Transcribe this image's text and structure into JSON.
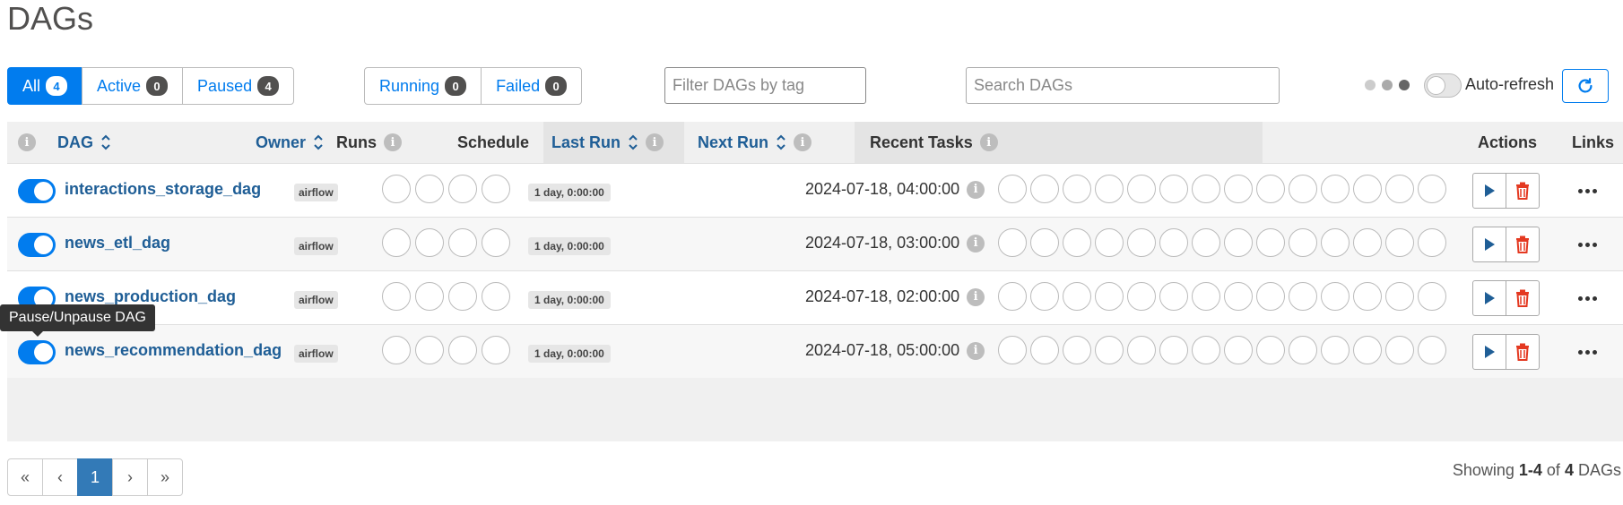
{
  "page": {
    "title": "DAGs"
  },
  "status_filter": [
    {
      "label": "All",
      "count": "4",
      "selected": true
    },
    {
      "label": "Active",
      "count": "0",
      "selected": false
    },
    {
      "label": "Paused",
      "count": "4",
      "selected": false
    }
  ],
  "run_filter": [
    {
      "label": "Running",
      "count": "0"
    },
    {
      "label": "Failed",
      "count": "0"
    }
  ],
  "tag_filter": {
    "placeholder": "Filter DAGs by tag"
  },
  "search": {
    "placeholder": "Search DAGs"
  },
  "auto_refresh": {
    "label": "Auto-refresh",
    "enabled": false
  },
  "table": {
    "headers": {
      "dag": "DAG",
      "owner": "Owner",
      "runs": "Runs",
      "schedule": "Schedule",
      "last_run": "Last Run",
      "next_run": "Next Run",
      "recent_tasks": "Recent Tasks",
      "actions": "Actions",
      "links": "Links"
    },
    "rows": [
      {
        "name": "interactions_storage_dag",
        "owner": "airflow",
        "schedule": "1 day, 0:00:00",
        "last_run": "",
        "next_run": "2024-07-18, 04:00:00",
        "active": true
      },
      {
        "name": "news_etl_dag",
        "owner": "airflow",
        "schedule": "1 day, 0:00:00",
        "last_run": "",
        "next_run": "2024-07-18, 03:00:00",
        "active": true
      },
      {
        "name": "news_production_dag",
        "owner": "airflow",
        "schedule": "1 day, 0:00:00",
        "last_run": "",
        "next_run": "2024-07-18, 02:00:00",
        "active": true
      },
      {
        "name": "news_recommendation_dag",
        "owner": "airflow",
        "schedule": "1 day, 0:00:00",
        "last_run": "",
        "next_run": "2024-07-18, 05:00:00",
        "active": true
      }
    ]
  },
  "tooltip": {
    "text": "Pause/Unpause DAG"
  },
  "pagination": {
    "first": "«",
    "prev": "‹",
    "current": "1",
    "next": "›",
    "last": "»"
  },
  "showing": {
    "prefix": "Showing",
    "range": "1-4",
    "of": "of",
    "total": "4",
    "suffix": "DAGs"
  },
  "colors": {
    "primary": "#017cee",
    "link": "#1f5e96",
    "danger": "#e43921"
  }
}
